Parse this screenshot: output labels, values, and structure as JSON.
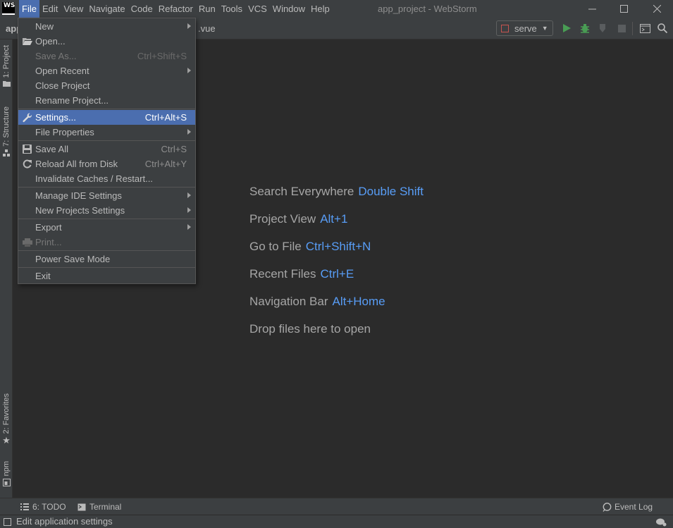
{
  "app": {
    "logo_text": "WS",
    "window_title": "app_project - WebStorm"
  },
  "menubar": {
    "items": [
      "File",
      "Edit",
      "View",
      "Navigate",
      "Code",
      "Refactor",
      "Run",
      "Tools",
      "VCS",
      "Window",
      "Help"
    ],
    "active": "File"
  },
  "navbar": {
    "project": "app",
    "file_suffix": ".vue"
  },
  "toolbar": {
    "run_config": "serve",
    "icons": [
      "run-icon",
      "debug-icon",
      "coverage-icon",
      "stop-icon",
      "terminal-icon",
      "search-icon"
    ]
  },
  "left_strip": {
    "project": "1: Project",
    "structure": "7: Structure",
    "favorites": "2: Favorites",
    "npm": "npm"
  },
  "file_menu": {
    "items": [
      {
        "label": "New",
        "submenu": true
      },
      {
        "label": "Open...",
        "icon": "folder-open-icon"
      },
      {
        "label": "Save As...",
        "shortcut": "Ctrl+Shift+S",
        "disabled": true
      },
      {
        "label": "Open Recent",
        "submenu": true
      },
      {
        "label": "Close Project"
      },
      {
        "label": "Rename Project..."
      },
      {
        "label": "Settings...",
        "shortcut": "Ctrl+Alt+S",
        "icon": "wrench-icon",
        "selected": true
      },
      {
        "label": "File Properties",
        "submenu": true
      },
      {
        "label": "Save All",
        "shortcut": "Ctrl+S",
        "icon": "save-icon"
      },
      {
        "label": "Reload All from Disk",
        "shortcut": "Ctrl+Alt+Y",
        "icon": "reload-icon"
      },
      {
        "label": "Invalidate Caches / Restart..."
      },
      {
        "label": "Manage IDE Settings",
        "submenu": true
      },
      {
        "label": "New Projects Settings",
        "submenu": true
      },
      {
        "label": "Export",
        "submenu": true
      },
      {
        "label": "Print...",
        "icon": "print-icon",
        "disabled": true
      },
      {
        "label": "Power Save Mode"
      },
      {
        "label": "Exit"
      }
    ]
  },
  "editor_hints": [
    {
      "label": "Search Everywhere",
      "key": "Double Shift"
    },
    {
      "label": "Project View",
      "key": "Alt+1"
    },
    {
      "label": "Go to File",
      "key": "Ctrl+Shift+N"
    },
    {
      "label": "Recent Files",
      "key": "Ctrl+E"
    },
    {
      "label": "Navigation Bar",
      "key": "Alt+Home"
    },
    {
      "label": "Drop files here to open",
      "key": ""
    }
  ],
  "bottom_tools": {
    "todo": "6: TODO",
    "terminal": "Terminal",
    "event_log": "Event Log"
  },
  "status": {
    "text": "Edit application settings"
  },
  "colors": {
    "background": "#2b2b2b",
    "panel": "#3c3f41",
    "selection": "#4b6eaf",
    "shortcut_key": "#589df6",
    "run_green": "#499c54"
  }
}
